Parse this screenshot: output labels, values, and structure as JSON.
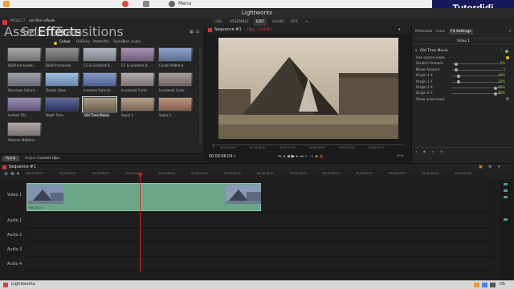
{
  "os": {
    "menu_label": "Menu"
  },
  "brand": {
    "text": "Tutordidi"
  },
  "app": {
    "title": "Lightworks"
  },
  "toolbar": {
    "project_label": "PROJECT",
    "project_name": "old film effect",
    "tabs": [
      "LOG",
      "ASSEMBLE",
      "EDIT",
      "AUDIO",
      "VFX",
      "+"
    ],
    "active_tab": "EDIT"
  },
  "left_panel": {
    "tabs": [
      "Assets",
      "Source",
      "Effects",
      "Transitions"
    ],
    "active_tab": "Effects",
    "filters": [
      "Colour",
      "DVE",
      "Key",
      "Matte",
      "Mix",
      "Stylize",
      "Text",
      "Audio"
    ],
    "active_filter": "Colour",
    "presets": [
      {
        "label": "B&W Increased...",
        "color": "#8c8c8c"
      },
      {
        "label": "B&W Increased...",
        "color": "#6f6f6f"
      },
      {
        "label": "CC & Gradient B...",
        "color": "#9aa0ad"
      },
      {
        "label": "CC & Gradient B...",
        "color": "#8d6f9b"
      },
      {
        "label": "Cooler Midtone",
        "color": "#6e86b7"
      },
      {
        "label": "Decrease Satura...",
        "color": "#7f8593"
      },
      {
        "label": "Dream Glow",
        "color": "#7fa9d8"
      },
      {
        "label": "Increase Saturat...",
        "color": "#5f78b8"
      },
      {
        "label": "Increased Contr...",
        "color": "#9a8f8f"
      },
      {
        "label": "Increased Contr...",
        "color": "#8d7d78"
      },
      {
        "label": "Instant 70s",
        "color": "#7b6a9c"
      },
      {
        "label": "Night Time",
        "color": "#303a78"
      },
      {
        "label": "Old Time Movie",
        "color": "#8b7b5d"
      },
      {
        "label": "Sepia 1",
        "color": "#9a7f66"
      },
      {
        "label": "Sepia 2",
        "color": "#a6715a"
      },
      {
        "label": "Warmer Midtone",
        "color": "#9a8a8a"
      }
    ],
    "selected_preset": "Old Time Movie",
    "apply_label": "Apply",
    "region_label": "Region",
    "region_value": "Current clip"
  },
  "viewer": {
    "title": "Sequence #1",
    "subtitle": "[Qty : 33131]",
    "timecode": "00:00:06:04",
    "ruler_ticks": [
      "00:00:00:00",
      "00:00:06:00",
      "00:00:12:00",
      "00:00:18:00",
      "00:00:24:00",
      "00:00:30:00"
    ]
  },
  "metadata": {
    "tabs": [
      "Metadata",
      "Cues",
      "FX Settings"
    ],
    "active_tab": "FX Settings",
    "subtab": "Video 1",
    "effect_name": "Old Time Movie",
    "params": [
      {
        "label": "Use source video",
        "value": "",
        "fill": null
      },
      {
        "label": "Scratch Amount",
        "value": "5%",
        "fill": 0.05
      },
      {
        "label": "Noise Amount",
        "value": "5",
        "fill": 0.05
      },
      {
        "label": "Origin 1 X",
        "value": "10%",
        "fill": 0.1
      },
      {
        "label": "Origin 1 Y",
        "value": "10%",
        "fill": 0.1
      },
      {
        "label": "Origin 2 X",
        "value": "90%",
        "fill": 0.9
      },
      {
        "label": "Origin 2 Y",
        "value": "90%",
        "fill": 0.9
      },
      {
        "label": "Show noise track",
        "value": "",
        "fill": null
      }
    ]
  },
  "timeline": {
    "sequence_name": "Sequence #1",
    "ruler_ticks": [
      "00:00:00:00",
      "00:00:04:00",
      "00:00:08:00",
      "00:00:12:00",
      "00:00:16:00",
      "00:00:20:00",
      "00:00:24:00",
      "00:00:28:00",
      "00:00:32:00",
      "00:00:36:00",
      "00:00:40:00",
      "00:00:44:00",
      "00:00:48:00",
      "00:00:52:00"
    ],
    "tracks": [
      "Video 1",
      "Audio 1",
      "Audio 2",
      "Audio 3",
      "Audio 4"
    ],
    "clip_label": "flip_0019"
  },
  "taskbar": {
    "app_label": "Lightworks",
    "locale": "US"
  },
  "colors": {
    "accent_red": "#e02222",
    "clip_green": "#6aa58a",
    "value_green": "#9bd14b",
    "brand_bg": "#161a5c"
  }
}
